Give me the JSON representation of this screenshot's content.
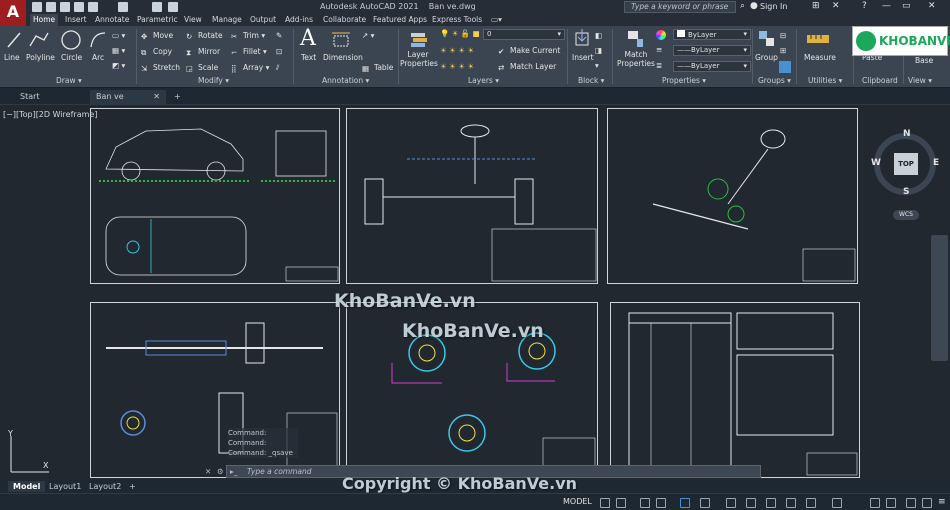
{
  "app": {
    "title": "Autodesk AutoCAD 2021",
    "file": "Ban ve.dwg",
    "logo_letter": "A",
    "search_placeholder": "Type a keyword or phrase",
    "signin": "Sign In"
  },
  "ribbon_tabs": [
    "Home",
    "Insert",
    "Annotate",
    "Parametric",
    "View",
    "Manage",
    "Output",
    "Add-ins",
    "Collaborate",
    "Featured Apps",
    "Express Tools"
  ],
  "ribbon": {
    "draw": {
      "title": "Draw",
      "line": "Line",
      "polyline": "Polyline",
      "circle": "Circle",
      "arc": "Arc"
    },
    "modify": {
      "title": "Modify",
      "move": "Move",
      "rotate": "Rotate",
      "trim": "Trim",
      "copy": "Copy",
      "mirror": "Mirror",
      "fillet": "Fillet",
      "stretch": "Stretch",
      "scale": "Scale",
      "array": "Array"
    },
    "annotation": {
      "title": "Annotation",
      "text": "Text",
      "dimension": "Dimension",
      "table": "Table"
    },
    "layers": {
      "title": "Layers",
      "layer_properties": "Layer Properties",
      "current_layer": "0",
      "make_current": "Make Current",
      "match_layer": "Match Layer"
    },
    "block": {
      "title": "Block",
      "insert": "Insert"
    },
    "properties": {
      "title": "Properties",
      "match_properties": "Match Properties",
      "color": "ByLayer",
      "linetype": "ByLayer",
      "lineweight": "ByLayer"
    },
    "groups": {
      "title": "Groups",
      "group": "Group"
    },
    "utilities": {
      "title": "Utilities",
      "measure": "Measure"
    },
    "clipboard": {
      "title": "Clipboard",
      "paste": "Paste"
    },
    "view": {
      "title": "View",
      "base": "Base"
    }
  },
  "doc_tabs": {
    "start": "Start",
    "current": "Ban ve",
    "add": "+"
  },
  "viewport": {
    "label": "[−][Top][2D Wireframe]",
    "viewcube": {
      "top": "TOP",
      "n": "N",
      "s": "S",
      "e": "E",
      "w": "W",
      "wcs": "WCS"
    }
  },
  "command": {
    "history": [
      "Command:",
      "Command:",
      "Command: _qsave"
    ],
    "placeholder": "Type a command"
  },
  "layout_tabs": [
    "Model",
    "Layout1",
    "Layout2"
  ],
  "status": {
    "model": "MODEL"
  },
  "watermarks": {
    "brand": "KHOBANVE",
    "site1": "KhoBanVe.vn",
    "site2": "KhoBanVe.vn",
    "copyright": "Copyright © KhoBanVe.vn"
  },
  "colors": {
    "accent": "#9f1d20",
    "ribbon": "#3b4552",
    "canvas": "#212830",
    "brand_green": "#1aa85a"
  }
}
